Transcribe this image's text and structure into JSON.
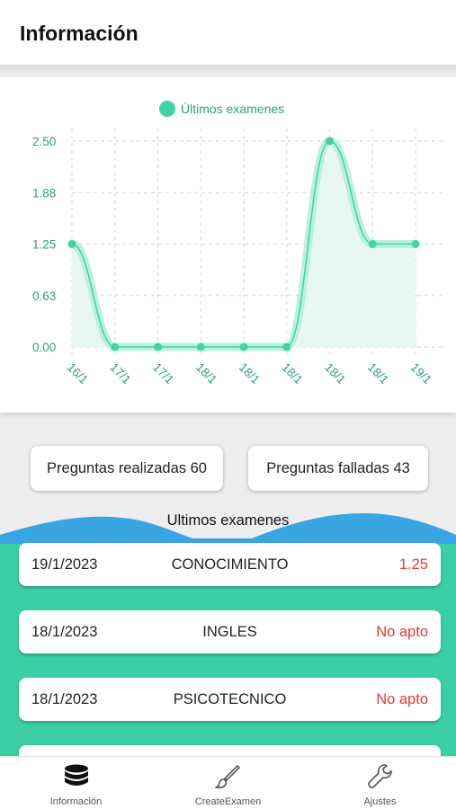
{
  "appbar": {
    "title": "Información"
  },
  "chart_data": {
    "type": "area",
    "legend": "Últimos examenes",
    "legend_position": "top-center",
    "categories": [
      "16/1",
      "17/1",
      "17/1",
      "18/1",
      "18/1",
      "18/1",
      "18/1",
      "18/1",
      "19/1"
    ],
    "series": [
      {
        "name": "Últimos examenes",
        "values": [
          1.25,
          0,
          0,
          0,
          0,
          0,
          2.5,
          1.25,
          1.25
        ]
      }
    ],
    "y_ticks": [
      "2.50",
      "1.88",
      "1.25",
      "0.63",
      "0.00"
    ],
    "ylim": [
      0,
      2.5
    ],
    "grid": true,
    "colors": {
      "line": "#41d3a6",
      "glow": "#b9f0de",
      "fill": "#e8f7f1",
      "grid": "#d5d5d5",
      "tick": "#2e9e84"
    }
  },
  "stats": {
    "realizadas": "Preguntas realizadas 60",
    "falladas": "Preguntas falladas 43"
  },
  "section_title": "Ultimos examenes",
  "exams": [
    {
      "date": "19/1/2023",
      "subject": "CONOCIMIENTO",
      "result": "1.25"
    },
    {
      "date": "18/1/2023",
      "subject": "INGLES",
      "result": "No apto"
    },
    {
      "date": "18/1/2023",
      "subject": "PSICOTECNICO",
      "result": "No apto"
    }
  ],
  "nav": [
    {
      "label": "Información",
      "icon": "database-icon"
    },
    {
      "label": "CreateExamen",
      "icon": "brush-icon"
    },
    {
      "label": "Ajustes",
      "icon": "wrench-icon"
    }
  ],
  "colors": {
    "teal": "#3ccfa3",
    "blue_wave": "#3aa5e3",
    "fail_red": "#e53935"
  }
}
